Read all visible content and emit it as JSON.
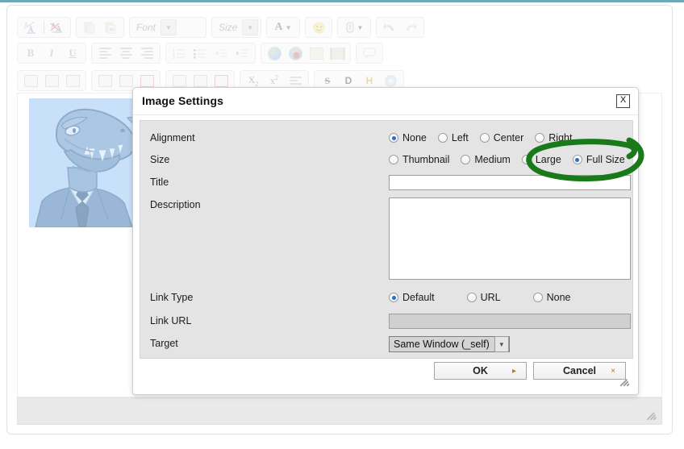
{
  "editor": {
    "toolbar_rows": [
      {
        "groups": [
          {
            "items": [
              {
                "name": "spellcheck-icon",
                "label": "A/A"
              },
              {
                "name": "remove-format-icon",
                "label": "A"
              }
            ]
          },
          {
            "items": [
              {
                "name": "paste-icon",
                "label": "paste"
              },
              {
                "name": "paste-from-word-icon",
                "label": "paste-word"
              }
            ]
          },
          {
            "items": [
              {
                "name": "font-family-select",
                "label": "Font"
              }
            ]
          },
          {
            "items": [
              {
                "name": "font-size-select",
                "label": "Size"
              }
            ]
          },
          {
            "items": [
              {
                "name": "text-color-icon",
                "label": "A"
              }
            ]
          },
          {
            "items": [
              {
                "name": "emoticon-icon",
                "label": "smiley"
              }
            ]
          },
          {
            "items": [
              {
                "name": "attachment-icon",
                "label": "attach"
              }
            ]
          },
          {
            "items": [
              {
                "name": "undo-icon",
                "label": "undo"
              },
              {
                "name": "redo-icon",
                "label": "redo"
              }
            ]
          }
        ]
      },
      {
        "groups": [
          {
            "items": [
              {
                "name": "bold-icon",
                "label": "B"
              },
              {
                "name": "italic-icon",
                "label": "I"
              },
              {
                "name": "underline-icon",
                "label": "U"
              }
            ]
          },
          {
            "items": [
              {
                "name": "align-left-icon",
                "label": "align-left"
              },
              {
                "name": "align-center-icon",
                "label": "align-center"
              },
              {
                "name": "align-right-icon",
                "label": "align-right"
              }
            ]
          },
          {
            "items": [
              {
                "name": "ordered-list-icon",
                "label": "ordered-list"
              },
              {
                "name": "unordered-list-icon",
                "label": "unordered-list"
              },
              {
                "name": "outdent-icon",
                "label": "outdent"
              },
              {
                "name": "indent-icon",
                "label": "indent"
              }
            ]
          },
          {
            "items": [
              {
                "name": "insert-link-icon",
                "label": "link"
              },
              {
                "name": "remove-link-icon",
                "label": "unlink"
              },
              {
                "name": "insert-image-icon",
                "label": "image"
              },
              {
                "name": "insert-media-icon",
                "label": "media"
              }
            ]
          },
          {
            "items": [
              {
                "name": "comment-icon",
                "label": "comment"
              }
            ]
          }
        ]
      },
      {
        "groups": [
          {
            "items": [
              {
                "name": "insert-table-icon",
                "label": "table"
              },
              {
                "name": "table-properties-icon",
                "label": "table-props"
              },
              {
                "name": "delete-table-icon",
                "label": "table-delete"
              }
            ]
          },
          {
            "items": [
              {
                "name": "insert-column-left-icon",
                "label": "col-left"
              },
              {
                "name": "insert-column-right-icon",
                "label": "col-right"
              },
              {
                "name": "delete-column-icon",
                "label": "col-delete"
              }
            ]
          },
          {
            "items": [
              {
                "name": "insert-row-above-icon",
                "label": "row-above"
              },
              {
                "name": "insert-row-below-icon",
                "label": "row-below"
              },
              {
                "name": "delete-row-icon",
                "label": "row-delete"
              }
            ]
          },
          {
            "items": [
              {
                "name": "subscript-icon",
                "label": "X2"
              },
              {
                "name": "superscript-icon",
                "label": "x2"
              },
              {
                "name": "blockquote-icon",
                "label": "blockquote"
              }
            ]
          },
          {
            "items": [
              {
                "name": "strikethrough-icon",
                "label": "S"
              },
              {
                "name": "definition-icon",
                "label": "D"
              },
              {
                "name": "highlight-icon",
                "label": "H"
              },
              {
                "name": "anchor-icon",
                "label": "anchor"
              }
            ]
          }
        ]
      }
    ],
    "content_image_alt": "dinosaur-in-suit-illustration"
  },
  "dialog": {
    "title": "Image Settings",
    "close_label": "X",
    "fields": {
      "alignment": {
        "label": "Alignment",
        "options": [
          {
            "label": "None",
            "selected": true
          },
          {
            "label": "Left",
            "selected": false
          },
          {
            "label": "Center",
            "selected": false
          },
          {
            "label": "Right",
            "selected": false
          }
        ]
      },
      "size": {
        "label": "Size",
        "options": [
          {
            "label": "Thumbnail",
            "selected": false
          },
          {
            "label": "Medium",
            "selected": false
          },
          {
            "label": "Large",
            "selected": false
          },
          {
            "label": "Full Size",
            "selected": true
          }
        ]
      },
      "title": {
        "label": "Title",
        "value": "",
        "placeholder": ""
      },
      "description": {
        "label": "Description",
        "value": "",
        "placeholder": ""
      },
      "link_type": {
        "label": "Link Type",
        "options": [
          {
            "label": "Default",
            "selected": true
          },
          {
            "label": "URL",
            "selected": false
          },
          {
            "label": "None",
            "selected": false
          }
        ]
      },
      "link_url": {
        "label": "Link URL",
        "value": "",
        "placeholder": "",
        "disabled": true
      },
      "target": {
        "label": "Target",
        "value": "Same Window (_self)"
      }
    },
    "buttons": {
      "ok": {
        "label": "OK",
        "mark": "▸"
      },
      "cancel": {
        "label": "Cancel",
        "mark": "×"
      }
    }
  },
  "annotation": {
    "shape": "hand-drawn-ellipse",
    "target_label": "Full Size",
    "color": "#1a7a1a"
  },
  "colors": {
    "top_accent": "#6fa8b8",
    "dialog_body": "#e4e4e4",
    "status_bar": "#e9e9e9",
    "image_backdrop": "#c8e0fa",
    "radio_selected": "#2a6fc4",
    "annotation_green": "#1a7a1a"
  }
}
